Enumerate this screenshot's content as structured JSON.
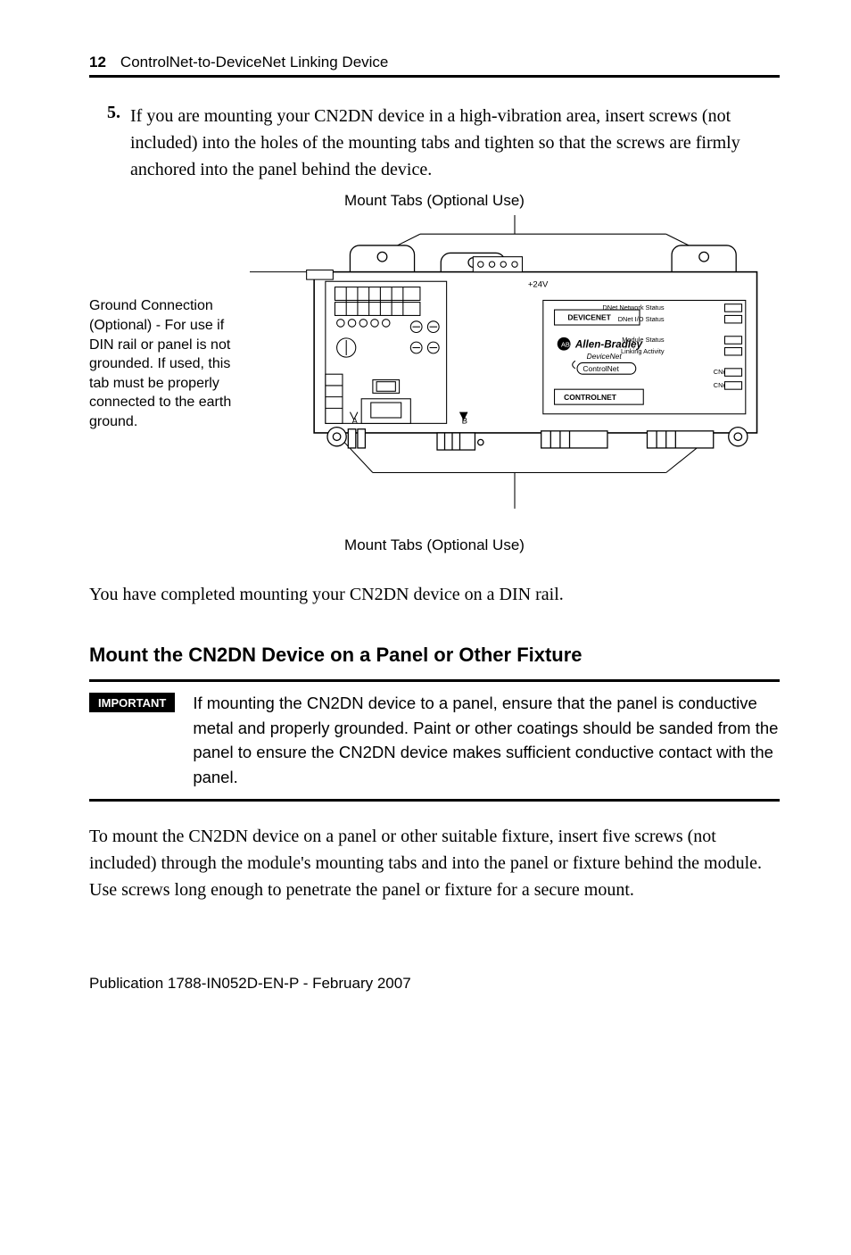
{
  "header": {
    "page_number": "12",
    "title": "ControlNet-to-DeviceNet Linking Device"
  },
  "step": {
    "number": "5.",
    "text": "If you are mounting your CN2DN device in a high-vibration area, insert screws (not included) into the holes of the mounting tabs and tighten so that the screws are firmly anchored into the panel behind the device."
  },
  "figure": {
    "caption_top": "Mount Tabs (Optional Use)",
    "left_annotation": "Ground Connection (Optional) - For use if DIN rail or panel is not grounded. If used, this tab must be properly connected to the earth ground.",
    "labels": {
      "plus24v": "+24V",
      "devicenet": "DEVICENET",
      "brand": "Allen-Bradley",
      "devnet": "DeviceNet",
      "cnet": "ControlNet",
      "controlnet_box": "CONTROLNET",
      "dnet_network_status": "DNet Network Status",
      "dnet_io_status": "DNet I/O Status",
      "module_status": "Module Status",
      "linking_activity": "Linking Activity",
      "cnet_a": "CNet A",
      "cnet_b": "CNet B",
      "port_a": "A",
      "port_b": "B"
    },
    "caption_bottom": "Mount Tabs (Optional Use)"
  },
  "completion_text": "You have completed mounting your CN2DN device on a DIN rail.",
  "section_heading": "Mount the CN2DN Device on a Panel or Other Fixture",
  "important": {
    "tag": "IMPORTANT",
    "text": "If mounting the CN2DN device to a panel, ensure that the panel is conductive metal and properly grounded.  Paint or other coatings should be sanded from the panel to ensure the CN2DN device makes sufficient conductive contact with the panel."
  },
  "mount_paragraph": "To mount the CN2DN device on a panel or other suitable fixture, insert five screws (not included) through the module's mounting tabs and into the panel or fixture behind the module. Use screws long enough to penetrate the panel or fixture for a secure mount.",
  "footer": "Publication 1788-IN052D-EN-P - February 2007"
}
